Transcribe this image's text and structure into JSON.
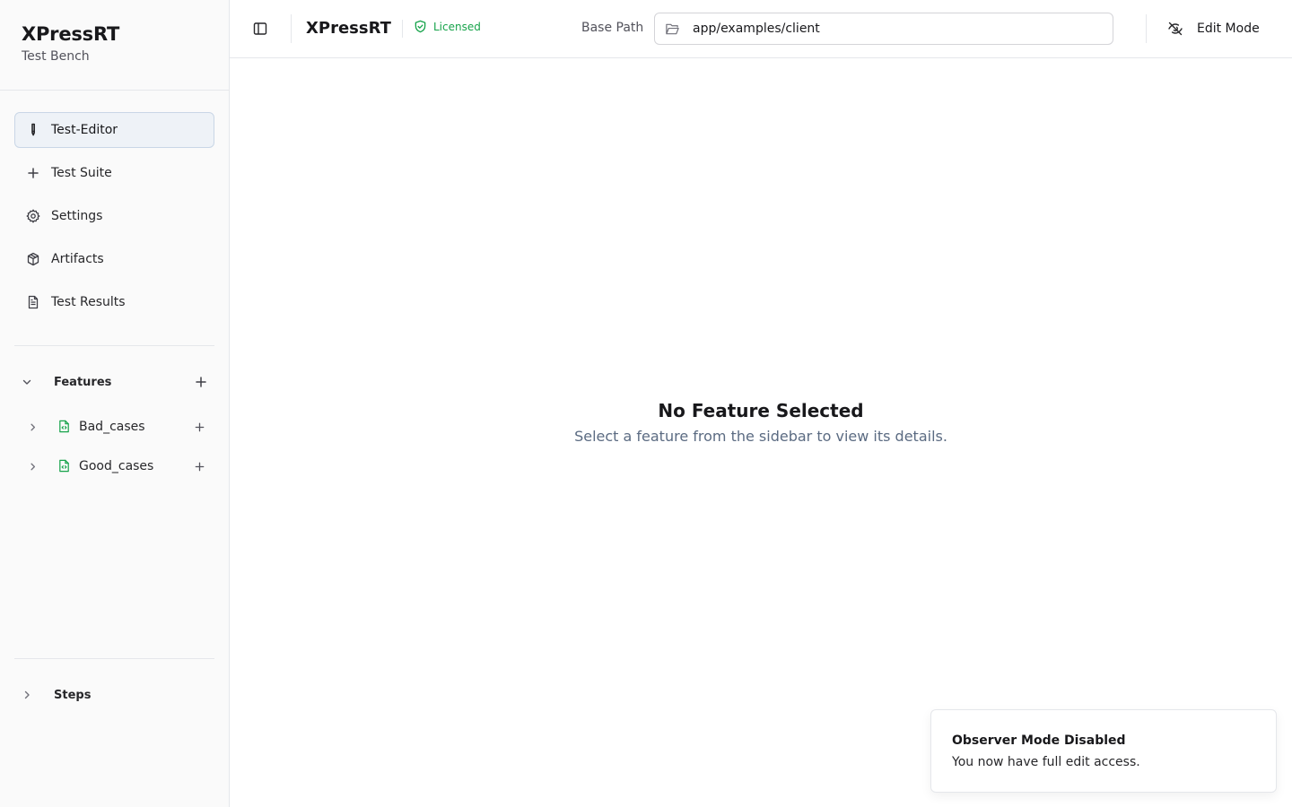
{
  "brand": {
    "title": "XPressRT",
    "subtitle": "Test Bench"
  },
  "nav": [
    {
      "label": "Test-Editor",
      "icon": "pen-icon",
      "active": true
    },
    {
      "label": "Test Suite",
      "icon": "plus-icon",
      "active": false
    },
    {
      "label": "Settings",
      "icon": "gear-icon",
      "active": false
    },
    {
      "label": "Artifacts",
      "icon": "package-icon",
      "active": false
    },
    {
      "label": "Test Results",
      "icon": "file-text-icon",
      "active": false
    }
  ],
  "features": {
    "label": "Features",
    "expanded": true,
    "items": [
      {
        "name": "Bad_cases",
        "icon": "file-code-icon"
      },
      {
        "name": "Good_cases",
        "icon": "file-code-icon"
      }
    ]
  },
  "steps": {
    "label": "Steps",
    "expanded": false
  },
  "header": {
    "app_name": "XPressRT",
    "license_label": "Licensed",
    "base_path_label": "Base Path",
    "base_path_value": "app/examples/client",
    "edit_mode_label": "Edit Mode"
  },
  "empty_state": {
    "title": "No Feature Selected",
    "subtitle": "Select a feature from the sidebar to view its details."
  },
  "toast": {
    "title": "Observer Mode Disabled",
    "description": "You now have full edit access."
  },
  "colors": {
    "accent_green": "#16a34a",
    "active_bg": "#eef2f7",
    "muted_text": "#5b6b82"
  }
}
